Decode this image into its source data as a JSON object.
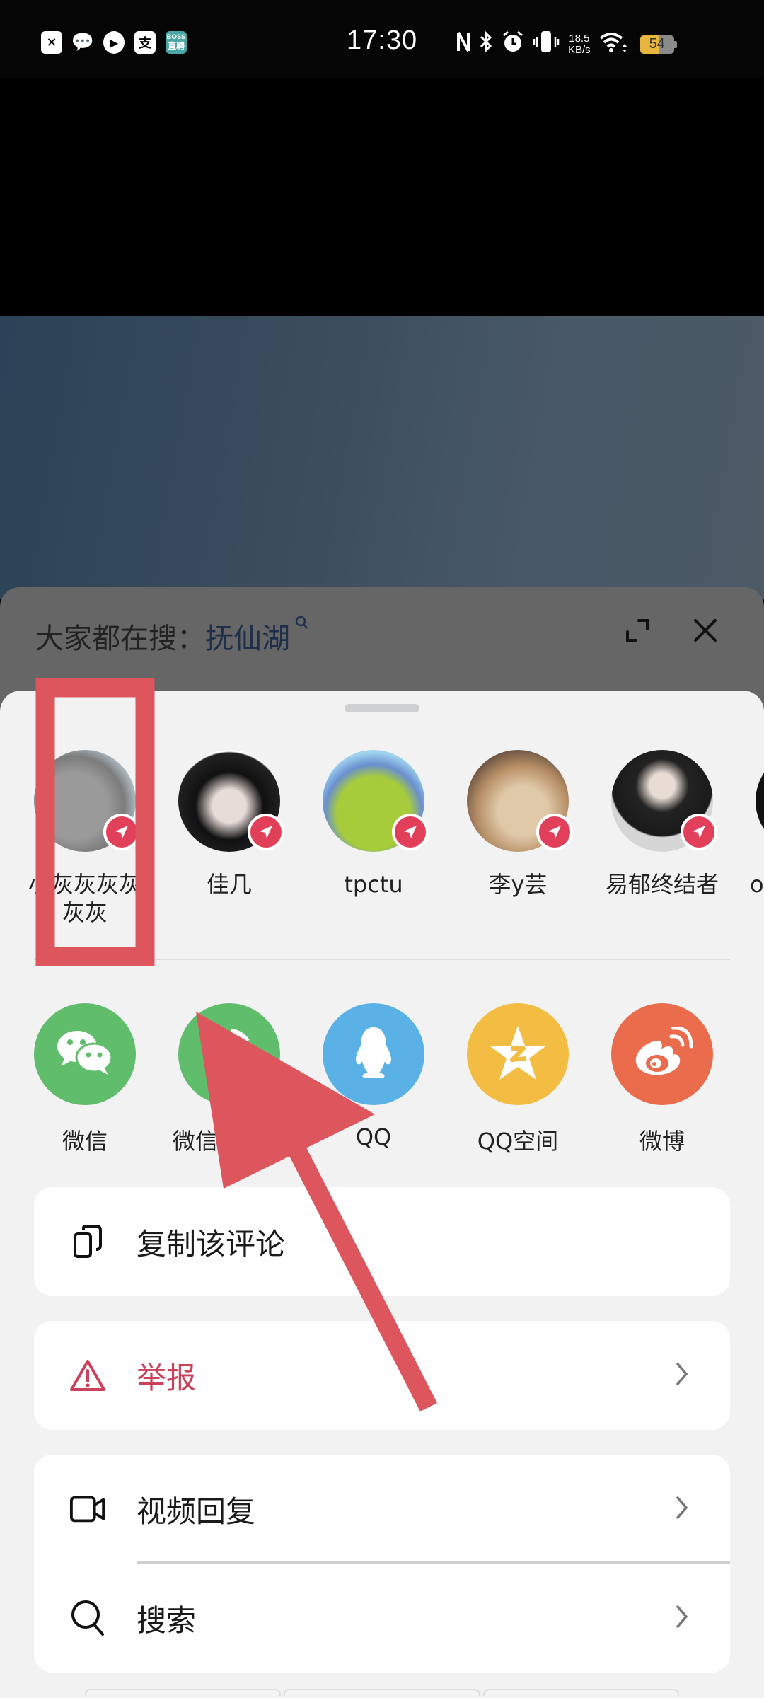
{
  "status_bar": {
    "time": "17:30",
    "left_icons": [
      "close-notification-icon",
      "wechat-icon",
      "video-app-icon",
      "alipay-icon",
      "boss-zhipin-icon"
    ],
    "boss_label_top": "BOSS",
    "boss_label_bottom": "直聘",
    "alipay_glyph": "支",
    "net_speed_value": "18.5",
    "net_speed_unit": "KB/s",
    "battery_level": 54,
    "battery_text": "54",
    "colors": {
      "battery": "#e8b63f",
      "boss": "#4aa7a5"
    }
  },
  "comment_panel": {
    "hot_search_prefix": "大家都在搜：",
    "hot_search_keyword": "抚仙湖"
  },
  "share_sheet": {
    "friends": [
      {
        "name": "小灰灰灰灰灰灰",
        "avatar": "grey-wolf-cartoon"
      },
      {
        "name": "佳几",
        "avatar": "anime-boy"
      },
      {
        "name": "tpctu",
        "avatar": "alien-toy"
      },
      {
        "name": "李y芸",
        "avatar": "shiba-dog"
      },
      {
        "name": "易郁终结者",
        "avatar": "person-hoodie"
      },
      {
        "name": "o灰",
        "avatar": "dark-avatar"
      }
    ],
    "apps": [
      {
        "label": "微信",
        "icon": "wechat-icon",
        "color": "#5fbd6b"
      },
      {
        "label": "微信朋友圈",
        "icon": "moments-icon",
        "color": "#5fbd6b"
      },
      {
        "label": "QQ",
        "icon": "qq-icon",
        "color": "#5ab1e6"
      },
      {
        "label": "QQ空间",
        "icon": "qzone-icon",
        "color": "#f2bd42"
      },
      {
        "label": "微博",
        "icon": "weibo-icon",
        "color": "#ea6c4c"
      }
    ],
    "actions": {
      "copy": "复制该评论",
      "report": "举报",
      "video_reply": "视频回复",
      "search": "搜索"
    },
    "colors": {
      "send_badge": "#e2405a",
      "danger": "#c9415a"
    }
  },
  "annotation": {
    "highlight_target": "friend-0",
    "arrow_target": "app-moments",
    "color": "#dd565e"
  }
}
